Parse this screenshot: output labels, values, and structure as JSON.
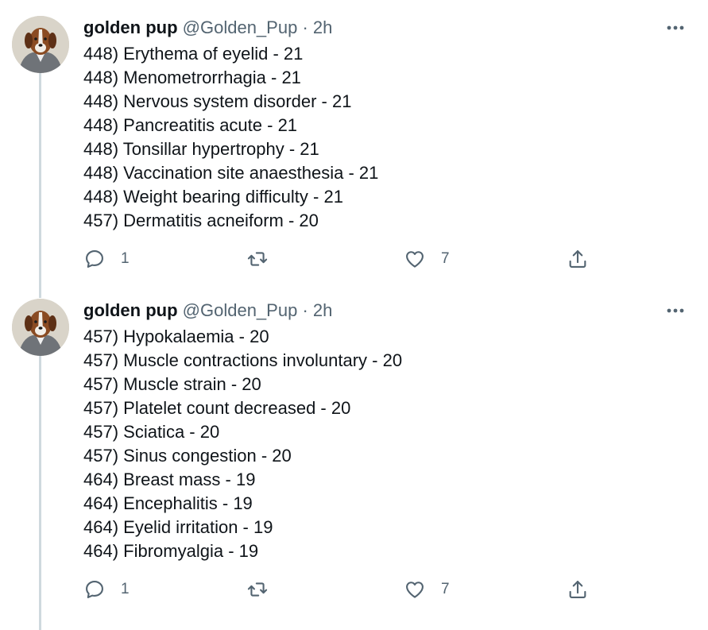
{
  "tweets": [
    {
      "author": {
        "name": "golden pup",
        "handle": "@Golden_Pup",
        "time": "2h"
      },
      "lines": [
        "448) Erythema of eyelid - 21",
        "448) Menometrorrhagia - 21",
        "448) Nervous system disorder - 21",
        "448) Pancreatitis acute - 21",
        "448) Tonsillar hypertrophy - 21",
        "448) Vaccination site anaesthesia - 21",
        "448) Weight bearing difficulty - 21",
        "457) Dermatitis acneiform - 20"
      ],
      "replies": "1",
      "likes": "7"
    },
    {
      "author": {
        "name": "golden pup",
        "handle": "@Golden_Pup",
        "time": "2h"
      },
      "lines": [
        "457) Hypokalaemia - 20",
        "457) Muscle contractions involuntary - 20",
        "457) Muscle strain - 20",
        "457) Platelet count decreased - 20",
        "457) Sciatica - 20",
        "457) Sinus congestion - 20",
        "464) Breast mass - 19",
        "464) Encephalitis - 19",
        "464) Eyelid irritation - 19",
        "464) Fibromyalgia - 19"
      ],
      "replies": "1",
      "likes": "7"
    }
  ],
  "separator": "·",
  "icons": {
    "reply": "reply-icon",
    "retweet": "retweet-icon",
    "like": "heart-icon",
    "share": "share-icon",
    "more": "more-icon"
  },
  "colors": {
    "text": "#0f1419",
    "secondary": "#536471",
    "thread_line": "#cfd9de"
  }
}
